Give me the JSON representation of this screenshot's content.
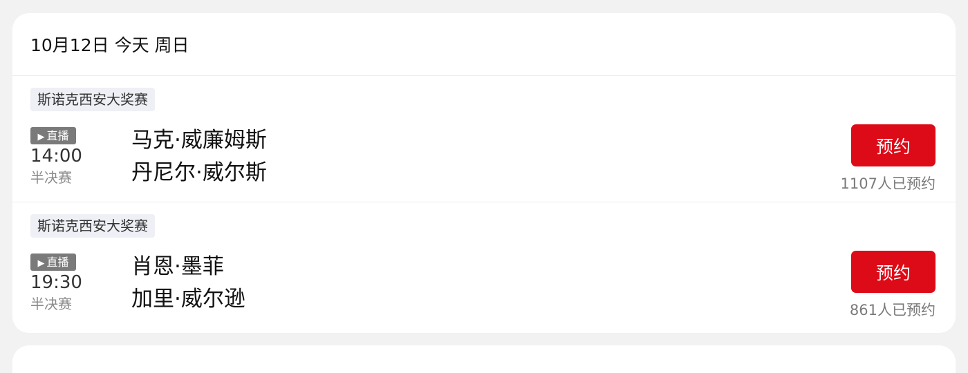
{
  "schedule": {
    "date_header": "10月12日 今天 周日",
    "matches": [
      {
        "tournament": "斯诺克西安大奖赛",
        "live_label": "直播",
        "time": "14:00",
        "stage": "半决赛",
        "player1": "马克·威廉姆斯",
        "player2": "丹尼尔·威尔斯",
        "reserve_label": "预约",
        "reserve_count": "1107人已预约"
      },
      {
        "tournament": "斯诺克西安大奖赛",
        "live_label": "直播",
        "time": "19:30",
        "stage": "半决赛",
        "player1": "肖恩·墨菲",
        "player2": "加里·威尔逊",
        "reserve_label": "预约",
        "reserve_count": "861人已预约"
      }
    ]
  },
  "colors": {
    "reserve_button": "#dd0a17",
    "live_badge": "#7a7a7a",
    "tag_background": "#eef0f5"
  }
}
